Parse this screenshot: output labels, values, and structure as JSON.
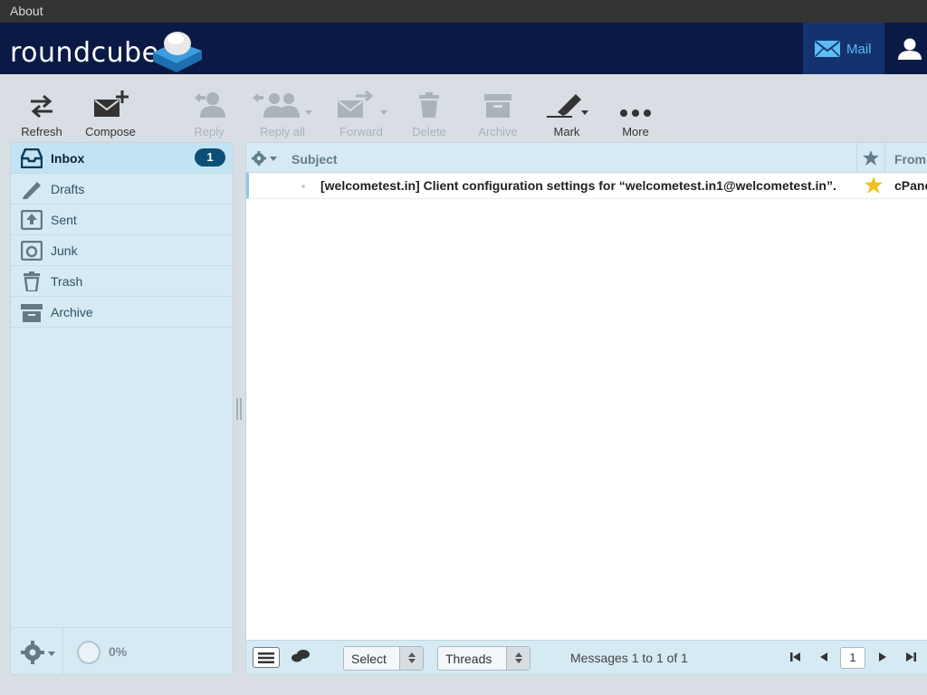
{
  "topbar": {
    "title": "About"
  },
  "header": {
    "logo_text": "roundcube",
    "nav": {
      "mail_label": "Mail",
      "mail_icon": "envelope-icon",
      "user_icon": "user-icon"
    }
  },
  "toolbar": {
    "refresh": "Refresh",
    "compose": "Compose",
    "reply": "Reply",
    "reply_all": "Reply all",
    "forward": "Forward",
    "delete": "Delete",
    "archive": "Archive",
    "mark": "Mark",
    "more": "More"
  },
  "folders": [
    {
      "label": "Inbox",
      "icon": "inbox-icon",
      "unread": "1",
      "selected": true
    },
    {
      "label": "Drafts",
      "icon": "pencil-icon"
    },
    {
      "label": "Sent",
      "icon": "sent-icon"
    },
    {
      "label": "Junk",
      "icon": "junk-icon"
    },
    {
      "label": "Trash",
      "icon": "trash-icon"
    },
    {
      "label": "Archive",
      "icon": "archive-icon"
    }
  ],
  "quota": {
    "text": "0%"
  },
  "message_list": {
    "columns": {
      "subject": "Subject",
      "from": "From"
    },
    "rows": [
      {
        "subject": "[welcometest.in] Client configuration settings for “welcometest.in1@welcometest.in”.",
        "from": "cPanel",
        "flagged": true,
        "unread": true
      }
    ]
  },
  "list_footer": {
    "select_label": "Select",
    "threads_label": "Threads",
    "count_text": "Messages 1 to 1 of 1",
    "page": "1"
  },
  "colors": {
    "header_bg": "#0a1a44",
    "accent": "#0b5177",
    "panel_bg": "#d6eaf4",
    "mail_nav_text": "#5bbdf3",
    "flag": "#f0c020"
  }
}
